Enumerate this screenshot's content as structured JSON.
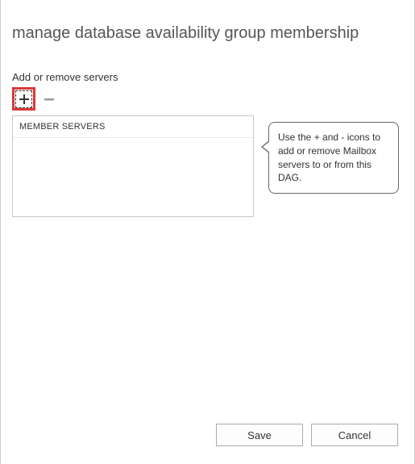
{
  "title": "manage database availability group membership",
  "section": {
    "label": "Add or remove servers"
  },
  "listbox": {
    "header": "MEMBER SERVERS"
  },
  "callout": {
    "text": "Use the + and - icons to add or remove Mailbox servers to or from this DAG."
  },
  "buttons": {
    "save": "Save",
    "cancel": "Cancel"
  },
  "icons": {
    "add": "plus-icon",
    "remove": "minus-icon"
  }
}
